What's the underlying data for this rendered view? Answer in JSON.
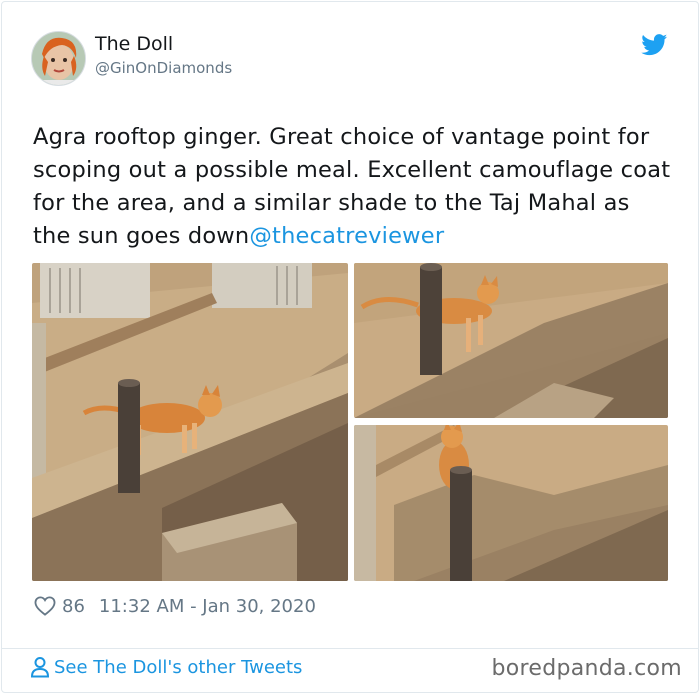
{
  "user": {
    "display_name": "The Doll",
    "handle": "@GinOnDiamonds",
    "avatar_icon": "avatar-face"
  },
  "brand": {
    "icon": "twitter-bird-icon",
    "color": "#1da1f2"
  },
  "tweet": {
    "text": "Agra rooftop ginger. Great choice of vantage point for scoping out a possible meal. Excellent camouflage coat for the area, and a similar shade to the Taj Mahal as the sun goes down",
    "mention": "@thecatreviewer"
  },
  "photos": [
    {
      "icon": "photo-cat-on-ledge-with-post"
    },
    {
      "icon": "photo-cat-walking-behind-post"
    },
    {
      "icon": "photo-cat-sitting-behind-post"
    }
  ],
  "meta": {
    "like_icon": "heart-icon",
    "likes": "86",
    "timestamp": "11:32 AM - Jan 30, 2020"
  },
  "footer": {
    "icon": "person-icon",
    "link_text": "See The Doll's other Tweets"
  },
  "watermark": "boredpanda.com",
  "colors": {
    "link": "#1b95e0",
    "muted": "#657786",
    "text": "#14171a",
    "border": "#e1e8ed"
  }
}
